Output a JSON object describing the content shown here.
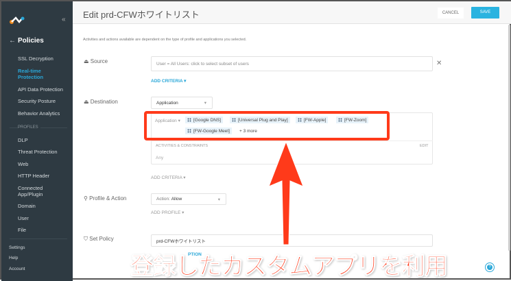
{
  "sidebar": {
    "section": "Policies",
    "items": [
      "SSL Decryption",
      "Real-time Protection",
      "API Data Protection",
      "Security Posture",
      "Behavior Analytics"
    ],
    "profiles_heading": "PROFILES",
    "profiles": [
      "DLP",
      "Threat Protection",
      "Web",
      "HTTP Header",
      "Connected App/Plugin",
      "Domain",
      "User",
      "File"
    ],
    "bottom": [
      "Settings",
      "Help",
      "Account"
    ]
  },
  "header": {
    "title": "Edit prd-CFWホワイトリスト",
    "cancel": "CANCEL",
    "save": "SAVE"
  },
  "info": "Activities and actions available are dependent on the type of profile and applications you selected.",
  "source": {
    "label": "Source",
    "value": "User = All Users: click to select subset of users",
    "add_criteria": "ADD CRITERIA ▾"
  },
  "destination": {
    "label": "Destination",
    "type": "Application",
    "filter_label": "Application ▾",
    "apps": [
      "[Google DNS]",
      "[Universal Plug and Play]",
      "[FW-Apple]",
      "[FW-Zoom]",
      "[FW-Google Meet]"
    ],
    "more": "+ 3 more",
    "activities_label": "ACTIVITIES & CONSTRAINTS",
    "edit": "EDIT",
    "activities_value": "Any",
    "add_criteria": "ADD CRITERIA ▾"
  },
  "profile": {
    "label": "Profile & Action",
    "action_prefix": "Action: ",
    "action": "Allow",
    "add_profile": "ADD PROFILE ▾"
  },
  "set_policy": {
    "label": "Set Policy",
    "value": "prd-CFWホワイトリスト",
    "option_link": "PTION"
  },
  "annotation": "登録したカスタムアプリを利用",
  "colors": {
    "accent": "#2aa7d8",
    "annotation": "#ff3a1a",
    "sidebar": "#2e3a42"
  }
}
